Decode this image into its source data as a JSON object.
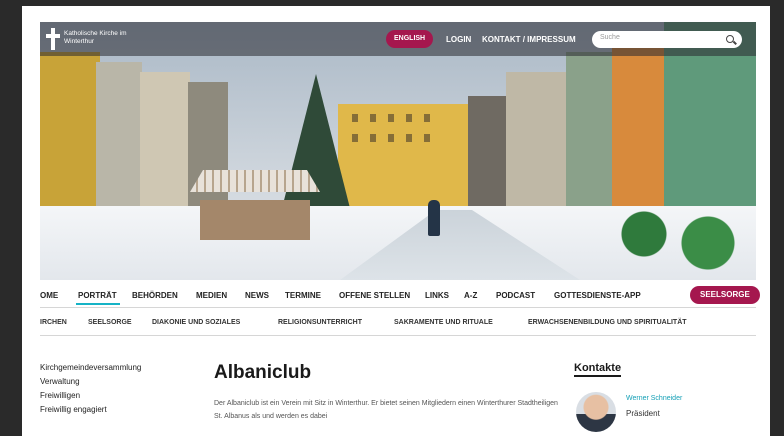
{
  "brand": {
    "name": "Katholische Kirche im Winterthur"
  },
  "topbar": {
    "language": "ENGLISH",
    "login": "LOGIN",
    "contact": "KONTAKT / IMPRESSUM",
    "search_placeholder": "Suche"
  },
  "nav": {
    "items": [
      "OME",
      "PORTRÄT",
      "BEHÖRDEN",
      "MEDIEN",
      "NEWS",
      "TERMINE",
      "OFFENE STELLEN",
      "LINKS",
      "A-Z",
      "PODCAST",
      "GOTTESDIENSTE-APP"
    ],
    "cta": "SEELSORGE"
  },
  "subnav": {
    "items": [
      "IRCHEN",
      "SEELSORGE",
      "DIAKONIE UND SOZIALES",
      "RELIGIONSUNTERRICHT",
      "SAKRAMENTE UND RITUALE",
      "ERWACHSENENBILDUNG UND SPIRITUALITÄT"
    ]
  },
  "sidebar": {
    "items": [
      "Kirchgemeindeversammlung",
      "Verwaltung",
      "Freiwilligen",
      "Freiwillig engagiert"
    ]
  },
  "main": {
    "title": "Albaniclub",
    "text": "Der Albaniclub ist ein Verein mit Sitz in Winterthur. Er bietet seinen Mitgliedern einen Winterthurer Stadtheiligen St. Albanus als und werden es dabei"
  },
  "contacts": {
    "title": "Kontakte",
    "name": "Werner Schneider",
    "role": "Präsident"
  },
  "colors": {
    "accent": "#a5174e",
    "active_underline": "#15b3c6"
  }
}
